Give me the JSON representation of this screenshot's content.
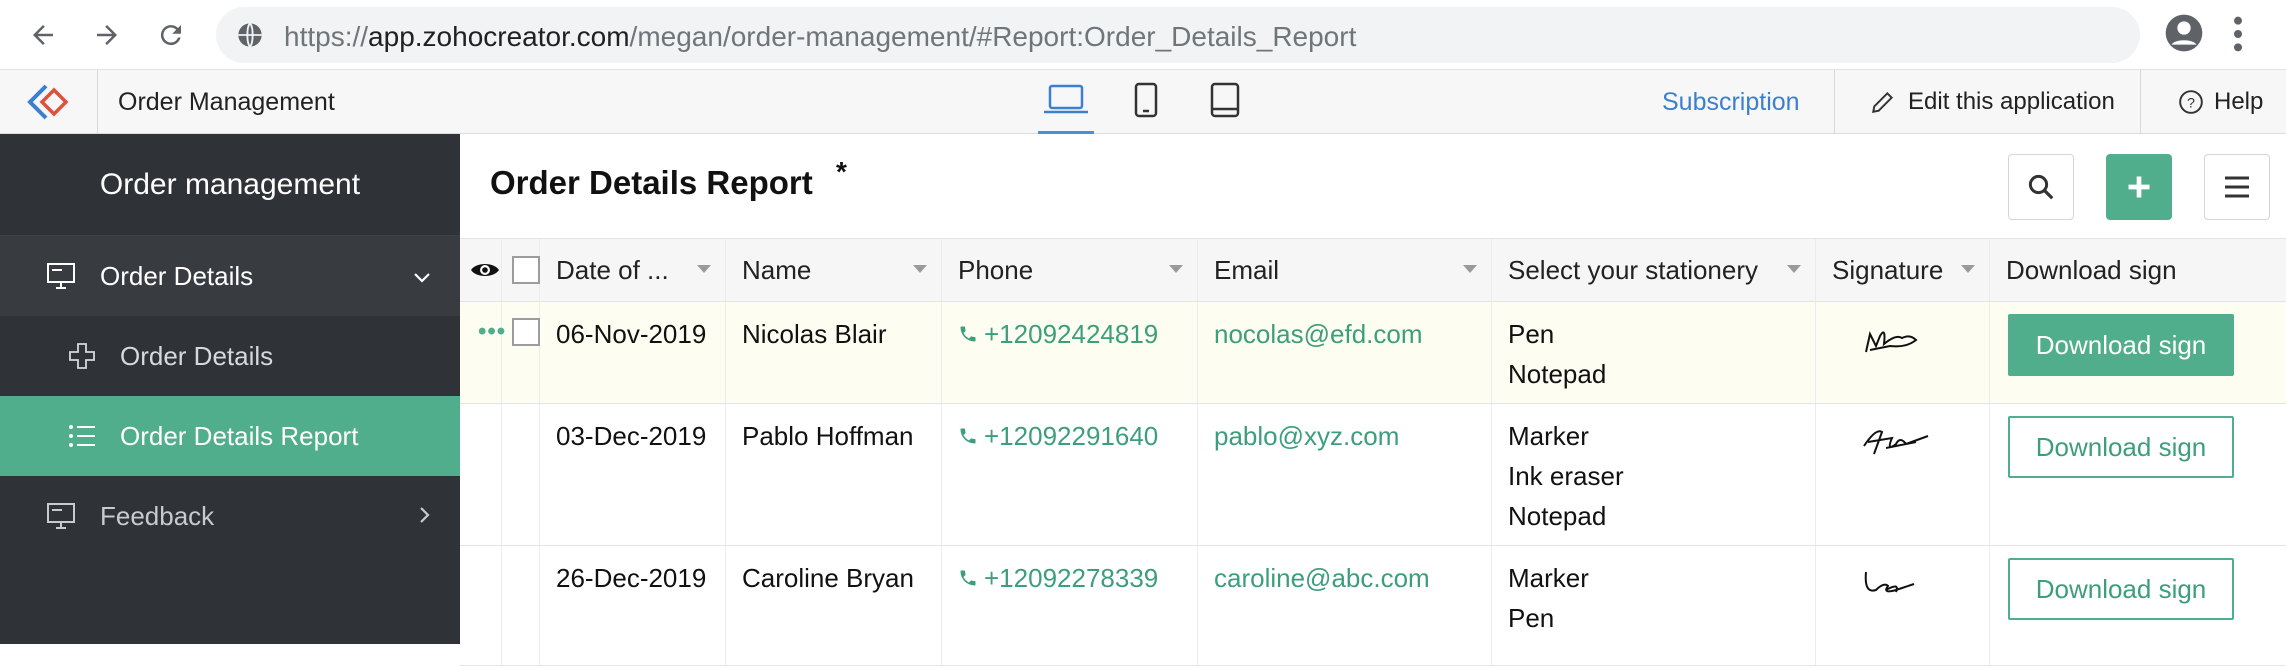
{
  "browser": {
    "url_prefix": "https://",
    "url_host": "app.zohocreator.com",
    "url_path": "/megan/order-management/#Report:Order_Details_Report"
  },
  "app_header": {
    "title": "Order Management",
    "subscription": "Subscription",
    "edit": "Edit this application",
    "help": "Help"
  },
  "sidebar": {
    "title": "Order management",
    "items": [
      {
        "label": "Order Details",
        "icon": "monitor-icon"
      },
      {
        "label": "Order Details",
        "icon": "plus-icon"
      },
      {
        "label": "Order Details Report",
        "icon": "list-icon"
      },
      {
        "label": "Feedback",
        "icon": "monitor-icon"
      }
    ]
  },
  "report": {
    "title": "Order Details Report",
    "unsaved_marker": "*"
  },
  "table": {
    "columns": [
      "Date of ...",
      "Name",
      "Phone",
      "Email",
      "Select your stationery",
      "Signature",
      "Download sign"
    ],
    "rows": [
      {
        "date": "06-Nov-2019",
        "name": "Nicolas Blair",
        "phone": "+12092424819",
        "email": "nocolas@efd.com",
        "stationery": [
          "Pen",
          "Notepad"
        ],
        "download": "Download sign"
      },
      {
        "date": "03-Dec-2019",
        "name": "Pablo Hoffman",
        "phone": "+12092291640",
        "email": "pablo@xyz.com",
        "stationery": [
          "Marker",
          "Ink eraser",
          "Notepad"
        ],
        "download": "Download sign"
      },
      {
        "date": "26-Dec-2019",
        "name": "Caroline Bryan",
        "phone": "+12092278339",
        "email": "caroline@abc.com",
        "stationery": [
          "Marker",
          "Pen"
        ],
        "download": "Download sign"
      }
    ]
  },
  "colors": {
    "accent": "#50ae8c",
    "sidebar": "#2f3236",
    "link": "#3b7fd0"
  }
}
